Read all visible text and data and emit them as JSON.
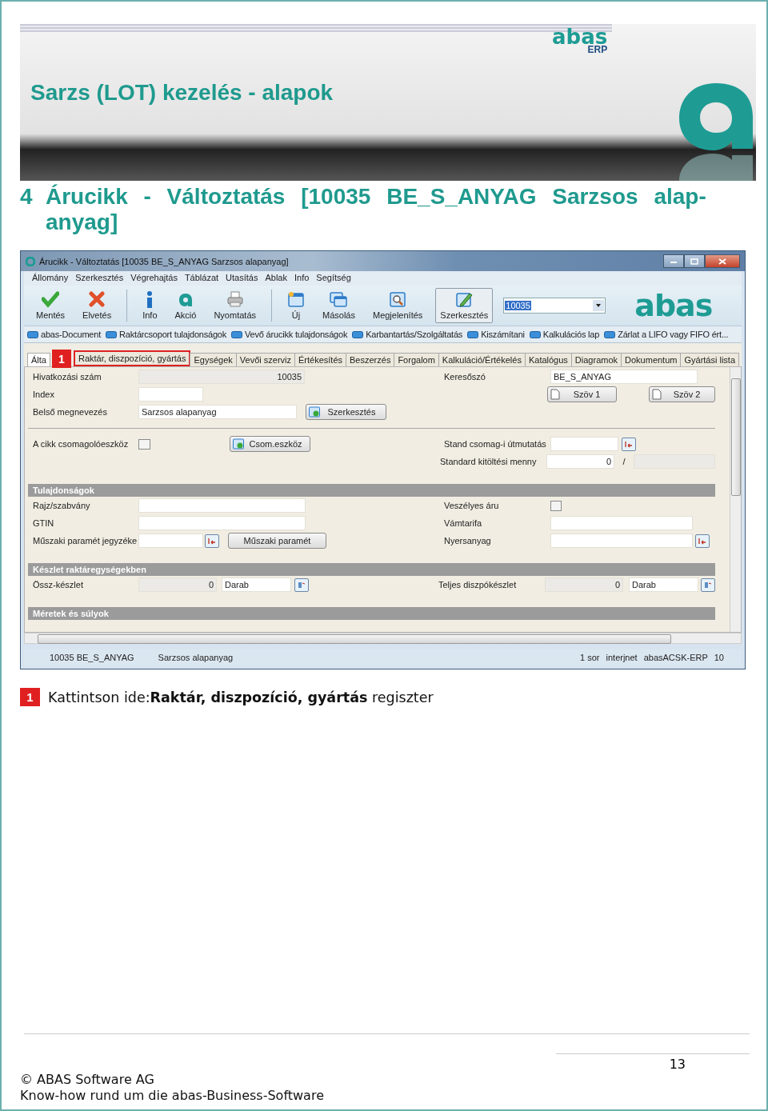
{
  "banner": {
    "title": "Sarzs (LOT) kezelés - alapok",
    "logo_text": "abas",
    "logo_sub": "ERP"
  },
  "heading": {
    "number": "4",
    "text": "Árucikk - Változtatás [10035 BE_S_ANYAG Sarzsos alap-anyag]"
  },
  "window": {
    "title": "Árucikk - Változtatás [10035  BE_S_ANYAG  Sarzsos alapanyag]",
    "menu": [
      "Állomány",
      "Szerkesztés",
      "Végrehajtás",
      "Táblázat",
      "Utasítás",
      "Ablak",
      "Info",
      "Segítség"
    ],
    "toolbar": {
      "groups": [
        [
          {
            "label": "Mentés",
            "selected": false
          },
          {
            "label": "Elvetés",
            "selected": false
          }
        ],
        [
          {
            "label": "Info",
            "selected": false
          },
          {
            "label": "Akció",
            "selected": false
          },
          {
            "label": "Nyomtatás",
            "selected": false
          }
        ],
        [
          {
            "label": "Új",
            "selected": false
          },
          {
            "label": "Másolás",
            "selected": false
          },
          {
            "label": "Megjelenítés",
            "selected": false
          },
          {
            "label": "Szerkesztés",
            "selected": true
          }
        ]
      ],
      "combo": {
        "value": "10035",
        "highlighted": true
      },
      "logo": "abas"
    },
    "links": [
      "abas-Document",
      "Raktárcsoport tulajdonságok",
      "Vevő árucikk tulajdonságok",
      "Karbantartás/Szolgáltatás",
      "Kiszámítani",
      "Kalkulációs lap",
      "Zárlat a LIFO vagy FIFO ért..."
    ],
    "tabs": [
      {
        "label": "Álta",
        "selected": true,
        "highlighted": false
      },
      {
        "label": "Raktár, diszpozíció, gyártás",
        "selected": false,
        "highlighted": true
      },
      {
        "label": "Egységek",
        "selected": false,
        "highlighted": false
      },
      {
        "label": "Vevői szerviz",
        "selected": false,
        "highlighted": false
      },
      {
        "label": "Értékesítés",
        "selected": false,
        "highlighted": false
      },
      {
        "label": "Beszerzés",
        "selected": false,
        "highlighted": false
      },
      {
        "label": "Forgalom",
        "selected": false,
        "highlighted": false
      },
      {
        "label": "Kalkuláció/Értékelés",
        "selected": false,
        "highlighted": false
      },
      {
        "label": "Katalógus",
        "selected": false,
        "highlighted": false
      },
      {
        "label": "Diagramok",
        "selected": false,
        "highlighted": false
      },
      {
        "label": "Dokumentum",
        "selected": false,
        "highlighted": false
      },
      {
        "label": "Gyártási lista",
        "selected": false,
        "highlighted": false
      }
    ],
    "callout": "1",
    "form": [
      {
        "kind": "row",
        "left": [
          {
            "kind": "label",
            "text": "Hivatkozási szám"
          },
          {
            "kind": "number-field",
            "value": "10035",
            "readonly": true
          }
        ],
        "right": [
          {
            "kind": "label",
            "text": "Keresőszó"
          },
          {
            "kind": "field",
            "value": "BE_S_ANYAG",
            "readonly": false
          }
        ]
      },
      {
        "kind": "row",
        "left": [
          {
            "kind": "label",
            "text": "Index"
          },
          {
            "kind": "field",
            "readonly": false
          }
        ],
        "right": [
          {
            "kind": "doc-button",
            "text": "Szöv 1"
          },
          {
            "kind": "doc-button",
            "text": "Szöv 2"
          }
        ]
      },
      {
        "kind": "row",
        "left": [
          {
            "kind": "label",
            "text": "Belső megnevezés"
          },
          {
            "kind": "field",
            "value": "Sarzsos alapanyag",
            "readonly": false
          },
          {
            "kind": "add-button",
            "text": "Szerkesztés"
          }
        ]
      },
      {
        "kind": "divider"
      },
      {
        "kind": "row",
        "left": [
          {
            "kind": "label",
            "text": "A cikk csomagolóeszköz"
          },
          {
            "kind": "checkbox",
            "checked": false
          },
          {
            "kind": "add-button",
            "text": "Csom.eszköz"
          }
        ],
        "right": [
          {
            "kind": "label",
            "text": "Stand csomag-i útmutatás"
          },
          {
            "kind": "field",
            "readonly": false
          },
          {
            "kind": "lookup"
          }
        ]
      },
      {
        "kind": "row",
        "right": [
          {
            "kind": "label",
            "text": "Standard kitöltési menny"
          },
          {
            "kind": "number-field",
            "value": "0",
            "readonly": false
          },
          {
            "kind": "text",
            "text": "/"
          },
          {
            "kind": "field",
            "readonly": true
          }
        ]
      },
      {
        "kind": "header",
        "text": "Tulajdonságok"
      },
      {
        "kind": "row",
        "left": [
          {
            "kind": "label",
            "text": "Rajz/szabvány"
          },
          {
            "kind": "field",
            "readonly": false
          }
        ],
        "right": [
          {
            "kind": "label",
            "text": "Veszélyes áru"
          },
          {
            "kind": "checkbox",
            "checked": false
          }
        ]
      },
      {
        "kind": "row",
        "left": [
          {
            "kind": "label",
            "text": "GTIN"
          },
          {
            "kind": "field",
            "readonly": false
          }
        ],
        "right": [
          {
            "kind": "label",
            "text": "Vámtarifa"
          },
          {
            "kind": "field",
            "readonly": false
          }
        ]
      },
      {
        "kind": "row",
        "left": [
          {
            "kind": "label",
            "text": "Műszaki paramét jegyzéke"
          },
          {
            "kind": "field",
            "readonly": false
          },
          {
            "kind": "lookup"
          },
          {
            "kind": "button",
            "text": "Műszaki paramét"
          }
        ],
        "right": [
          {
            "kind": "label",
            "text": "Nyersanyag"
          },
          {
            "kind": "field",
            "readonly": false
          },
          {
            "kind": "lookup"
          }
        ]
      },
      {
        "kind": "header",
        "text": "Készlet raktáregységekben"
      },
      {
        "kind": "row",
        "left": [
          {
            "kind": "label",
            "text": "Össz-készlet"
          },
          {
            "kind": "number-field",
            "value": "0",
            "readonly": true
          },
          {
            "kind": "field",
            "value": "Darab",
            "readonly": false
          },
          {
            "kind": "unit-lookup"
          }
        ],
        "right": [
          {
            "kind": "label",
            "text": "Teljes diszpókészlet"
          },
          {
            "kind": "number-field",
            "value": "0",
            "readonly": true
          },
          {
            "kind": "field",
            "value": "Darab",
            "readonly": false
          },
          {
            "kind": "unit-lookup"
          }
        ]
      },
      {
        "kind": "header",
        "text": "Méretek és súlyok"
      }
    ],
    "status": [
      "10035 BE_S_ANYAG",
      "Sarzsos alapanyag",
      "1 sor",
      "interjnet",
      "abasACSK-ERP",
      "10"
    ]
  },
  "instruction": {
    "badge": "1",
    "text": "Kattintson ide:**Raktár, diszpozíció, gyártás** regiszter"
  },
  "footer": {
    "page": "13",
    "copyright": "© ABAS Software AG",
    "tagline": "Know-how rund um die abas-Business-Software"
  }
}
